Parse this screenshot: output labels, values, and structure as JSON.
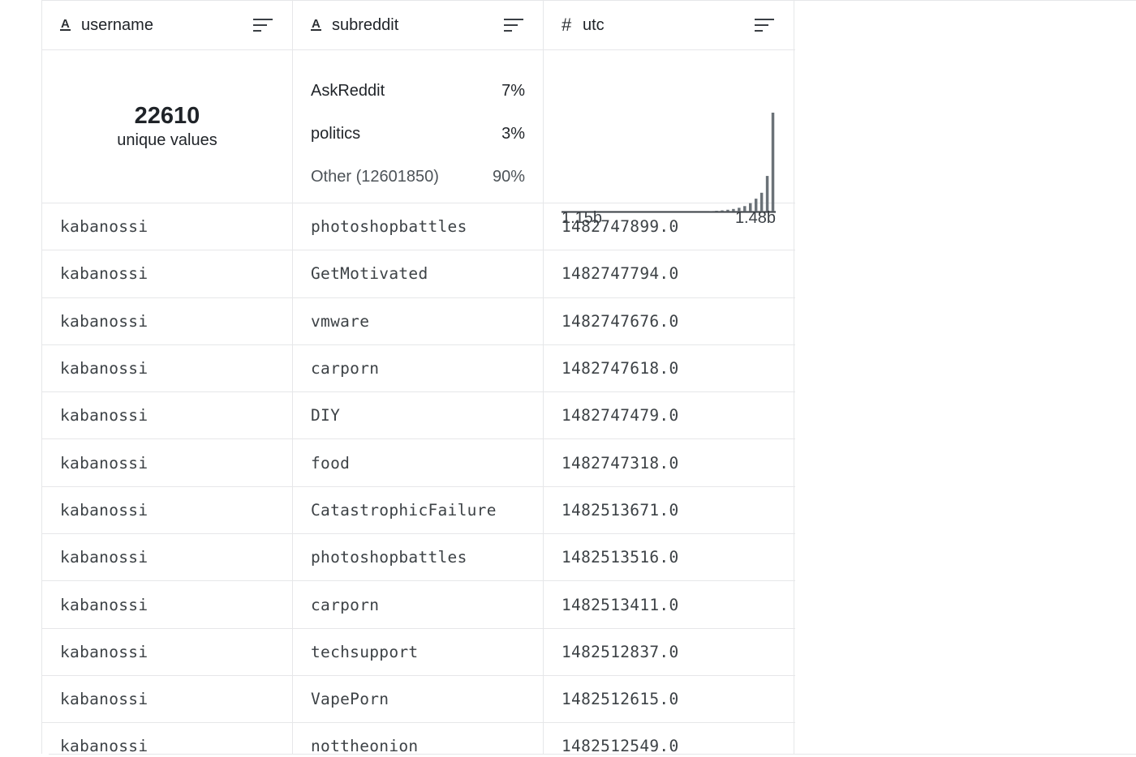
{
  "columns": [
    {
      "name": "username",
      "type_icon": "text-type-icon",
      "sort_icon": "sort-lines-icon"
    },
    {
      "name": "subreddit",
      "type_icon": "text-type-icon",
      "sort_icon": "sort-lines-icon"
    },
    {
      "name": "utc",
      "type_icon": "number-type-icon",
      "sort_icon": "sort-lines-icon"
    }
  ],
  "summary": {
    "username": {
      "unique_count": "22610",
      "unique_label": "unique values"
    },
    "subreddit": {
      "categories": [
        {
          "label": "AskReddit",
          "pct": "7%"
        },
        {
          "label": "politics",
          "pct": "3%"
        },
        {
          "label": "Other (12601850)",
          "pct": "90%"
        }
      ]
    },
    "utc": {
      "min_label": "1.15b",
      "max_label": "1.48b",
      "histogram": [
        0,
        0,
        0,
        0,
        0,
        0,
        0,
        0,
        0,
        0,
        0,
        0,
        0,
        0,
        0,
        0,
        0,
        0,
        0,
        0,
        0,
        0,
        0,
        0,
        0,
        0,
        0.5,
        0.8,
        1.2,
        1.8,
        2.6,
        3.8,
        5.5,
        8.5,
        13,
        19,
        36,
        100
      ]
    }
  },
  "rows": [
    {
      "username": "kabanossi",
      "subreddit": "photoshopbattles",
      "utc": "1482747899.0"
    },
    {
      "username": "kabanossi",
      "subreddit": "GetMotivated",
      "utc": "1482747794.0"
    },
    {
      "username": "kabanossi",
      "subreddit": "vmware",
      "utc": "1482747676.0"
    },
    {
      "username": "kabanossi",
      "subreddit": "carporn",
      "utc": "1482747618.0"
    },
    {
      "username": "kabanossi",
      "subreddit": "DIY",
      "utc": "1482747479.0"
    },
    {
      "username": "kabanossi",
      "subreddit": "food",
      "utc": "1482747318.0"
    },
    {
      "username": "kabanossi",
      "subreddit": "CatastrophicFailure",
      "utc": "1482513671.0"
    },
    {
      "username": "kabanossi",
      "subreddit": "photoshopbattles",
      "utc": "1482513516.0"
    },
    {
      "username": "kabanossi",
      "subreddit": "carporn",
      "utc": "1482513411.0"
    },
    {
      "username": "kabanossi",
      "subreddit": "techsupport",
      "utc": "1482512837.0"
    },
    {
      "username": "kabanossi",
      "subreddit": "VapePorn",
      "utc": "1482512615.0"
    },
    {
      "username": "kabanossi",
      "subreddit": "nottheonion",
      "utc": "1482512549.0"
    }
  ]
}
